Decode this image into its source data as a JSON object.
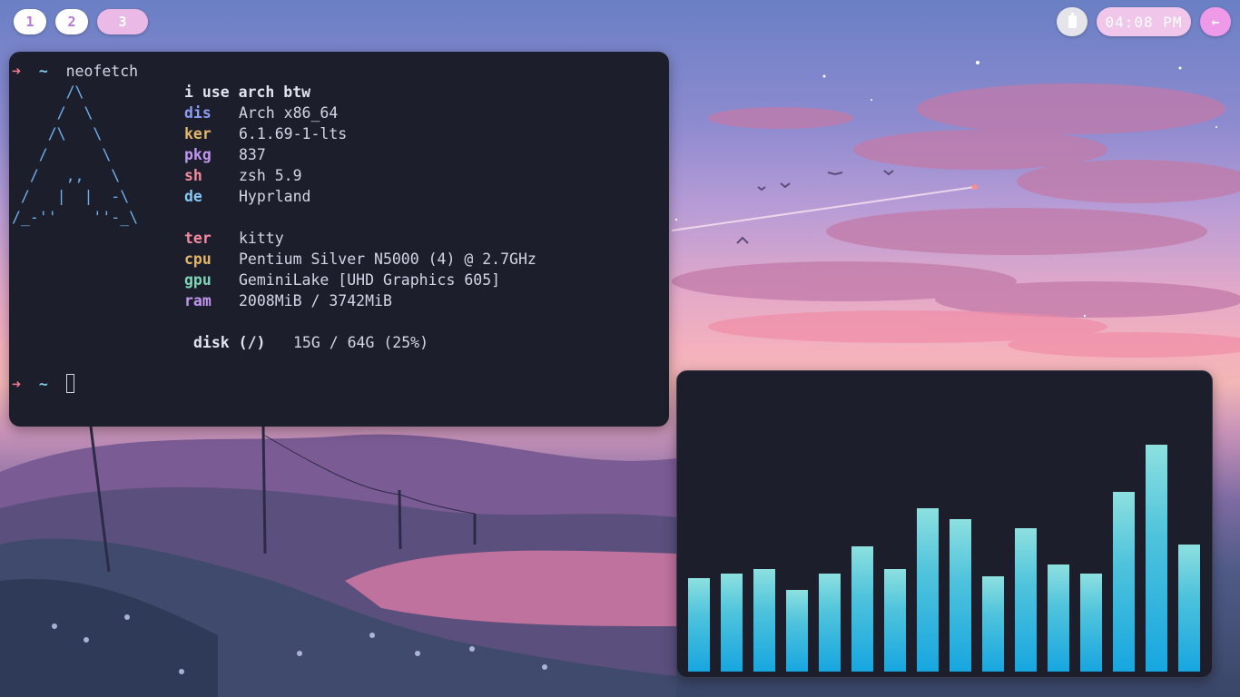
{
  "workspaces": [
    {
      "label": "1",
      "active": false
    },
    {
      "label": "2",
      "active": false
    },
    {
      "label": "3",
      "active": true
    }
  ],
  "status": {
    "battery_icon": "battery-icon",
    "clock": "04:08 PM",
    "power_icon": "←"
  },
  "terminal": {
    "prompt_arrow": "➜",
    "prompt_dir": "~",
    "command": "neofetch",
    "logo": [
      "      /\\",
      "     /  \\",
      "    /\\   \\",
      "   /      \\",
      "  /   ,,   \\",
      " /   |  |  -\\",
      "/_-''    ''-_\\"
    ],
    "header": "i use arch btw",
    "info": [
      {
        "key": "dis",
        "value": "Arch x86_64",
        "color": "#8b9ef0"
      },
      {
        "key": "ker",
        "value": "6.1.69-1-lts",
        "color": "#e3b769"
      },
      {
        "key": "pkg",
        "value": "837",
        "color": "#c196f0"
      },
      {
        "key": "sh",
        "value": "zsh 5.9",
        "color": "#f28aa0"
      },
      {
        "key": "de",
        "value": "Hyprland",
        "color": "#86c8f2"
      },
      {
        "key": "ter",
        "value": "kitty",
        "color": "#f28aa0"
      },
      {
        "key": "cpu",
        "value": "Pentium Silver N5000 (4) @ 2.7GHz",
        "color": "#e3b769"
      },
      {
        "key": "gpu",
        "value": "GeminiLake [UHD Graphics 605]",
        "color": "#7fd6b6"
      },
      {
        "key": "ram",
        "value": "2008MiB / 3742MiB",
        "color": "#c196f0"
      }
    ],
    "disk_label": "disk (/)",
    "disk_value": "15G / 64G (25%)"
  },
  "visualizer": {
    "levels": [
      0.41,
      0.43,
      0.45,
      0.36,
      0.43,
      0.55,
      0.45,
      0.72,
      0.67,
      0.42,
      0.63,
      0.47,
      0.43,
      0.79,
      1.0,
      0.56
    ]
  },
  "colors": {
    "terminal_bg": "#1d1e2b",
    "accent_pink": "#ef9ae8",
    "workspace_active": "#eab9e6",
    "bar_top": "#8de0df",
    "bar_bottom": "#17a6e0"
  }
}
